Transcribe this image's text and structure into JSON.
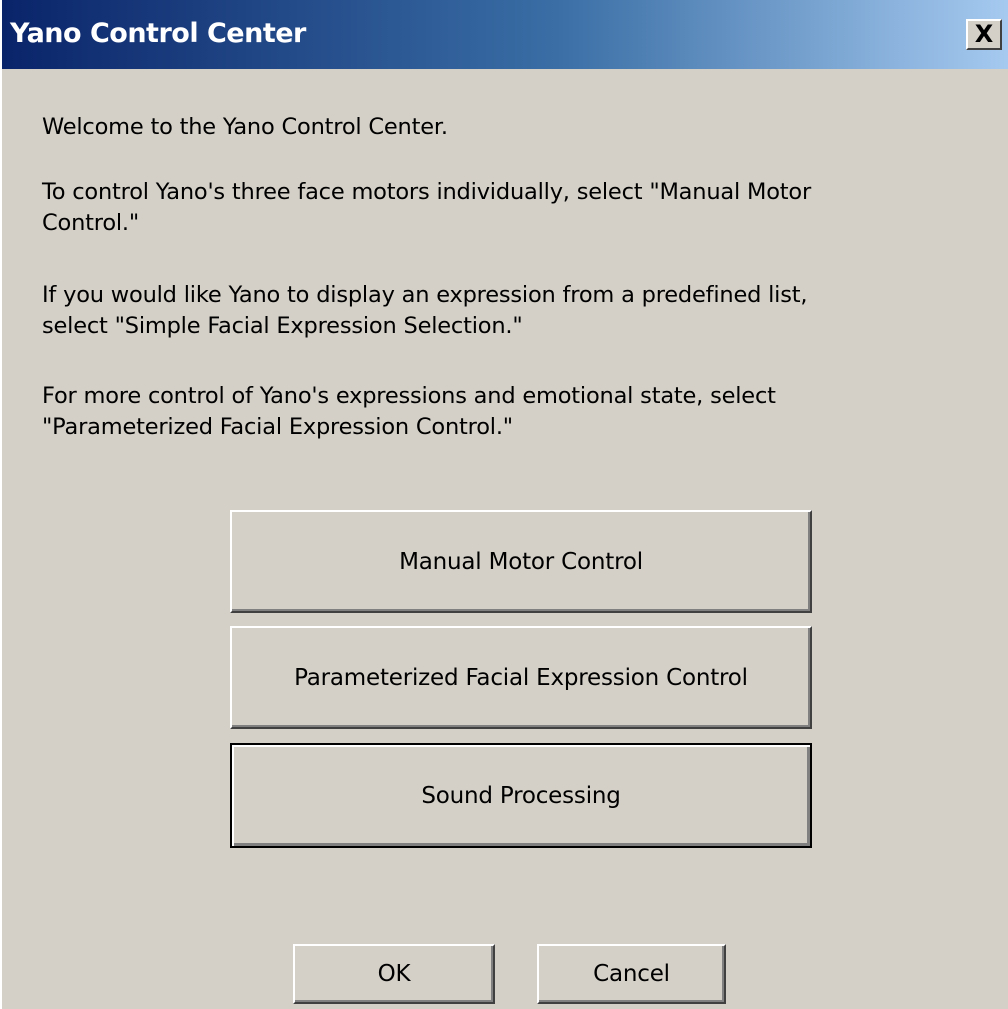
{
  "window": {
    "title": "Yano Control Center",
    "close_glyph": "X"
  },
  "intro": {
    "welcome": "Welcome to the Yano Control Center.",
    "manual_line1": "To control Yano's three face motors individually, select \"Manual Motor",
    "manual_line2": "Control.\"",
    "simple_line1": "If you would like Yano to display an expression from a predefined list,",
    "simple_line2": "select \"Simple Facial Expression Selection.\"",
    "param_line1": "For more control of Yano's expressions and emotional state, select",
    "param_line2": "\"Parameterized Facial Expression Control.\""
  },
  "options": {
    "manual_motor": "Manual Motor Control",
    "parameterized": "Parameterized Facial Expression Control",
    "sound": "Sound Processing"
  },
  "footer": {
    "ok": "OK",
    "cancel": "Cancel"
  }
}
